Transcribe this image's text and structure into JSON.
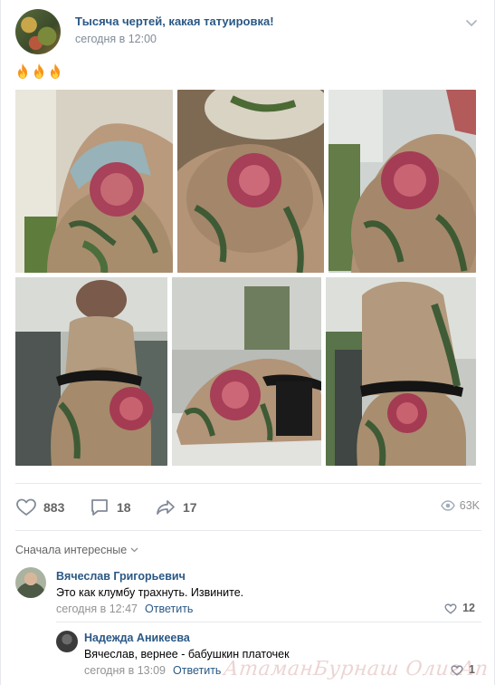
{
  "post": {
    "group_name": "Тысяча чертей, какая татуировка!",
    "date": "сегодня в 12:00",
    "emoji_text": "🔥🔥🔥",
    "photos": [
      {
        "alt": "tattoo photo 1"
      },
      {
        "alt": "tattoo photo 2"
      },
      {
        "alt": "tattoo photo 3"
      },
      {
        "alt": "tattoo photo 4"
      },
      {
        "alt": "tattoo photo 5"
      },
      {
        "alt": "tattoo photo 6"
      }
    ],
    "icons": {
      "more": "chevron-down-icon",
      "fire": "fire-icon"
    }
  },
  "actions": {
    "likes": "883",
    "comments": "18",
    "shares": "17",
    "views": "63K",
    "icons": {
      "like": "heart-icon",
      "comment": "comment-icon",
      "share": "share-icon",
      "views": "eye-icon"
    }
  },
  "comments": {
    "sort_label": "Сначала интересные",
    "items": [
      {
        "author": "Вячеслав Григорьевич",
        "text": "Это как клумбу трахнуть. Извините.",
        "time": "сегодня в 12:47",
        "reply_label": "Ответить",
        "likes": "12"
      }
    ],
    "reply": {
      "author": "Надежда Аникеева",
      "text": "Вячеслав, вернее - бабушкин платочек",
      "time": "сегодня в 13:09",
      "reply_label": "Ответить",
      "likes": "1"
    }
  },
  "watermark": "АтаманБурнаш ОлигАп",
  "colors": {
    "link": "#2a5885",
    "meta": "#939393",
    "divider": "#e7e8ec"
  }
}
